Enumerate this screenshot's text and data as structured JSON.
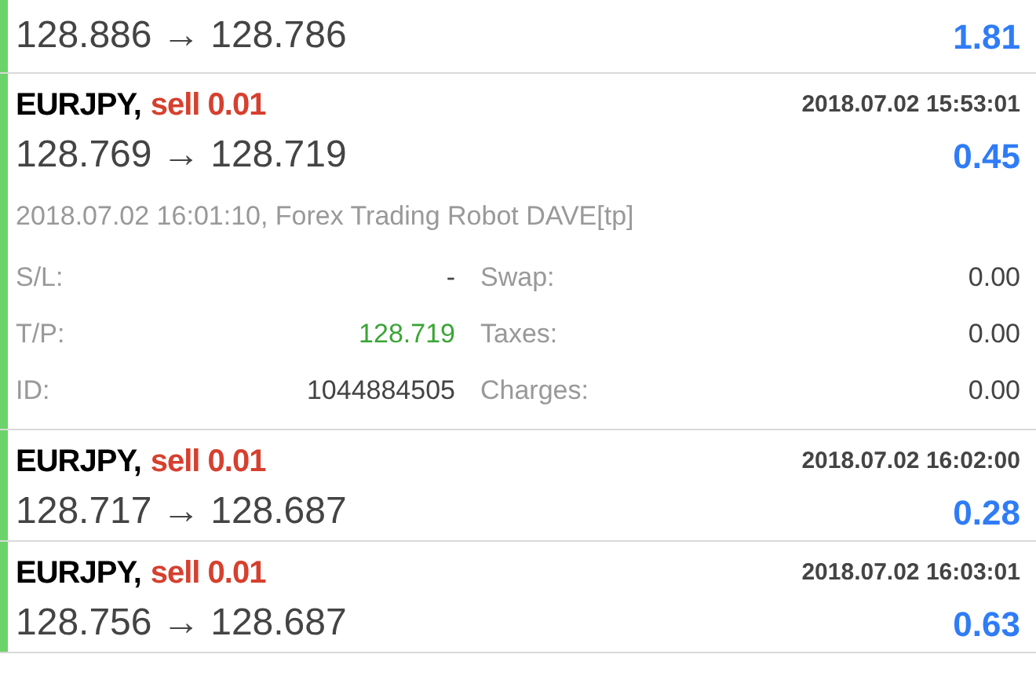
{
  "trades": [
    {
      "prices": "128.886 → 128.786",
      "profit": "1.81",
      "expanded": false
    },
    {
      "symbol": "EURJPY,",
      "kind": "sell",
      "order": "sell 0.01",
      "time": "2018.07.02 15:53:01",
      "prices": "128.769 → 128.719",
      "profit": "0.45",
      "expanded": true,
      "comment": "2018.07.02 16:01:10, Forex Trading Robot DAVE[tp]",
      "details": [
        {
          "label": "S/L:",
          "value": "-",
          "label2": "Swap:",
          "value2": "0.00",
          "kind": "plain"
        },
        {
          "label": "T/P:",
          "value": "128.719",
          "label2": "Taxes:",
          "value2": "0.00",
          "kind": "target"
        },
        {
          "label": "ID:",
          "value": "1044884505",
          "label2": "Charges:",
          "value2": "0.00",
          "kind": "plain"
        }
      ]
    },
    {
      "symbol": "EURJPY,",
      "kind": "sell",
      "order": "sell 0.01",
      "time": "2018.07.02 16:02:00",
      "prices": "128.717 → 128.687",
      "profit": "0.28",
      "expanded": false
    },
    {
      "symbol": "EURJPY,",
      "kind": "sell",
      "order": "sell 0.01",
      "time": "2018.07.02 16:03:01",
      "prices": "128.756 → 128.687",
      "profit": "0.63",
      "expanded": false
    }
  ]
}
